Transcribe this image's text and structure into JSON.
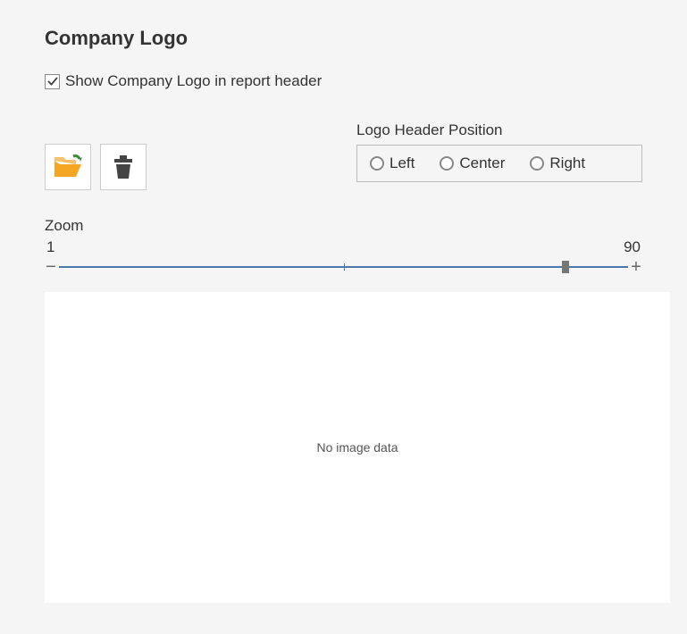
{
  "title": "Company Logo",
  "checkbox": {
    "label": "Show Company Logo in report header",
    "checked": true
  },
  "position": {
    "group_label": "Logo Header Position",
    "options": [
      "Left",
      "Center",
      "Right"
    ]
  },
  "zoom": {
    "label": "Zoom",
    "min_label": "1",
    "max_label": "90",
    "value_percent": 89
  },
  "preview": {
    "placeholder": "No image data"
  }
}
